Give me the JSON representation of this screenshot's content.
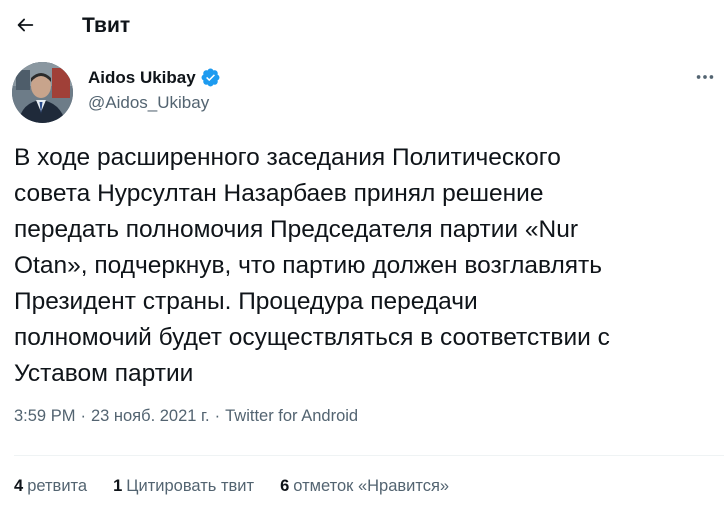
{
  "header": {
    "title": "Твит"
  },
  "author": {
    "name": "Aidos Ukibay",
    "handle": "@Aidos_Ukibay",
    "verified": true
  },
  "tweet": {
    "text": "В ходе расширенного заседания Политического\nсовета Нурсултан Назарбаев принял решение\nпередать полномочия Председателя партии «Nur\nOtan», подчеркнув, что партию должен возглавлять\nПрезидент страны. Процедура передачи\nполномочий будет осуществляться в соответствии с\nУставом партии"
  },
  "meta": {
    "time": "3:59 PM",
    "separator": "·",
    "date": "23 нояб. 2021 г.",
    "source": "Twitter for Android"
  },
  "stats": {
    "retweets_count": "4",
    "retweets_label": "ретвита",
    "quotes_count": "1",
    "quotes_label": "Цитировать твит",
    "likes_count": "6",
    "likes_label": "отметок «Нравится»"
  },
  "colors": {
    "text_primary": "#0f1419",
    "text_secondary": "#536471",
    "verified_blue": "#1d9bf0",
    "divider": "#eff3f4"
  },
  "icons": {
    "back": "arrow-left-icon",
    "verified": "verified-badge-icon",
    "more": "more-horizontal-icon"
  }
}
